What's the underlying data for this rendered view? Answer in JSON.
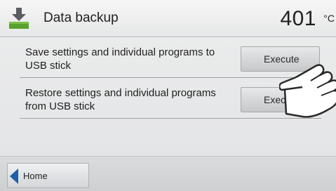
{
  "header": {
    "title": "Data backup",
    "temperature": "401",
    "temperature_unit": "°C",
    "icon": "download-to-device-icon"
  },
  "actions": [
    {
      "label": "Save settings and individual programs to USB stick",
      "button_label": "Execute"
    },
    {
      "label": "Restore settings and individual programs from USB stick",
      "button_label": "Execute"
    }
  ],
  "footer": {
    "home_label": "Home",
    "home_icon": "back-arrow-icon"
  },
  "overlay": {
    "icon": "pointing-hand-icon"
  },
  "colors": {
    "accent": "#1d5fa8",
    "background": "#e4e5e7"
  }
}
